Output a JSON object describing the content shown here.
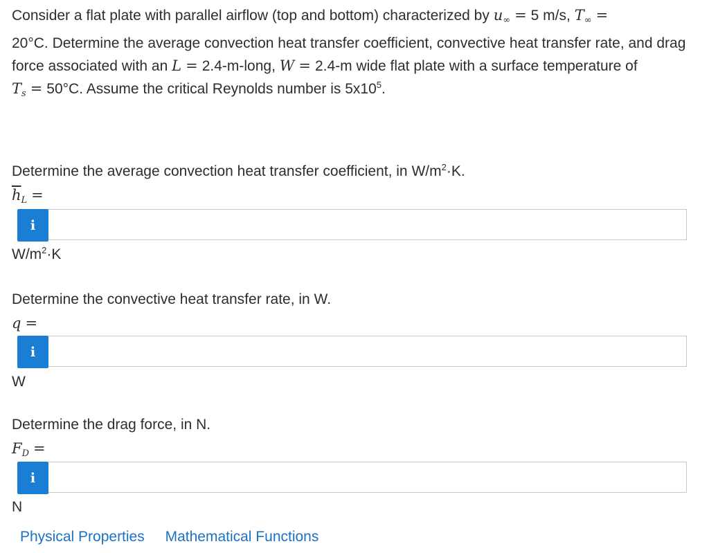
{
  "problem": {
    "p1": "Consider a flat plate with parallel airflow (top and bottom) characterized by ",
    "u_inf_var": "u",
    "u_inf_value": "5 m/s,",
    "T_inf_var": "T",
    "p2": "20°C. Determine the average convection heat transfer coefficient, convective heat transfer rate, and drag force associated with an ",
    "L_var": "L",
    "L_value": "2.4-m-long,",
    "W_var": "W",
    "W_value": "2.4-m wide flat plate with a surface temperature of",
    "Ts_var": "T",
    "Ts_value": "50°C. Assume the critical Reynolds number is 5x10",
    "Re_exp": "5",
    "end": ".",
    "inf_sub": "∞",
    "s_sub": "s",
    "eq_sign": "="
  },
  "questions": [
    {
      "prompt": "Determine the average convection heat transfer coefficient, in W/m",
      "prompt_sup": "2",
      "prompt_end": "·K.",
      "symbol": "h",
      "symbol_sub": "L",
      "info_label": "i",
      "value": "",
      "unit": "W/m",
      "unit_sup": "2",
      "unit_end": "·K"
    },
    {
      "prompt": "Determine the convective heat transfer rate, in W.",
      "symbol": "q",
      "info_label": "i",
      "value": "",
      "unit": "W"
    },
    {
      "prompt": "Determine the drag force, in N.",
      "symbol": "F",
      "symbol_sub": "D",
      "info_label": "i",
      "value": "",
      "unit": "N"
    }
  ],
  "links": {
    "physical_properties": "Physical Properties",
    "math_functions": "Mathematical Functions"
  },
  "colors": {
    "info_button": "#1a7fd4",
    "link": "#1a72c2"
  }
}
